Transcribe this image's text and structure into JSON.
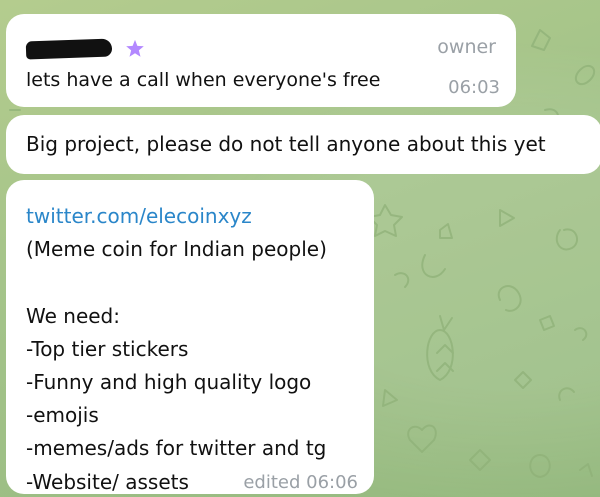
{
  "chat": {
    "messages": [
      {
        "sender_badge": "owner",
        "text": "lets have a call when everyone's free",
        "time": "06:03"
      },
      {
        "text": "Big project, please do not tell anyone about this yet"
      },
      {
        "link": "twitter.com/elecoinxyz",
        "lines": [
          "(Meme coin for Indian people)",
          "",
          "We need:",
          "-Top tier stickers",
          "-Funny and high quality logo",
          "-emojis",
          "-memes/ads for twitter and tg",
          "-Website/ assets"
        ],
        "time": "edited 06:06"
      }
    ]
  },
  "colors": {
    "link": "#2a86c9",
    "star": "#b388ff",
    "meta_text": "#9aa0a6",
    "background": "#a8c48a"
  },
  "icons": {
    "sender_star": "star-icon"
  }
}
